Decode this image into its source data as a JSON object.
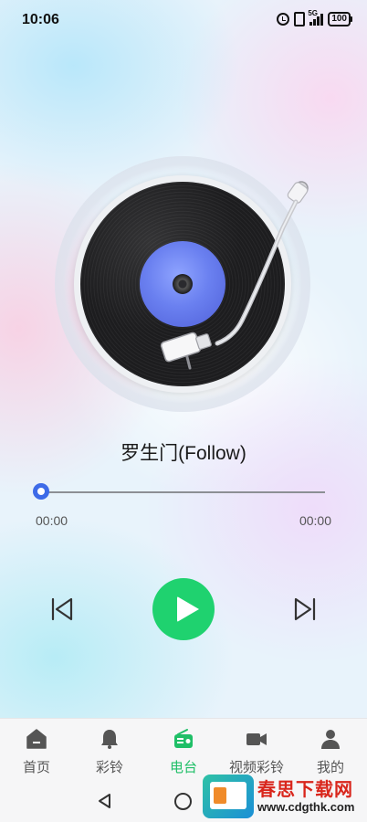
{
  "status_bar": {
    "time": "10:06",
    "network": "5G",
    "battery": "100"
  },
  "player": {
    "song_title": "罗生门(Follow)",
    "current_time": "00:00",
    "total_time": "00:00",
    "progress": 0,
    "accent_color": "#3e6be8",
    "play_button_color": "#1fd26f"
  },
  "bottom_nav": {
    "items": [
      {
        "label": "首页",
        "icon": "home-icon"
      },
      {
        "label": "彩铃",
        "icon": "bell-icon"
      },
      {
        "label": "电台",
        "icon": "radio-icon",
        "active": true
      },
      {
        "label": "视频彩铃",
        "icon": "video-camera-icon"
      },
      {
        "label": "我的",
        "icon": "user-icon"
      }
    ],
    "active_color": "#1fbf67"
  },
  "watermark": {
    "title": "春思下载网",
    "url": "www.cdgthk.com"
  }
}
